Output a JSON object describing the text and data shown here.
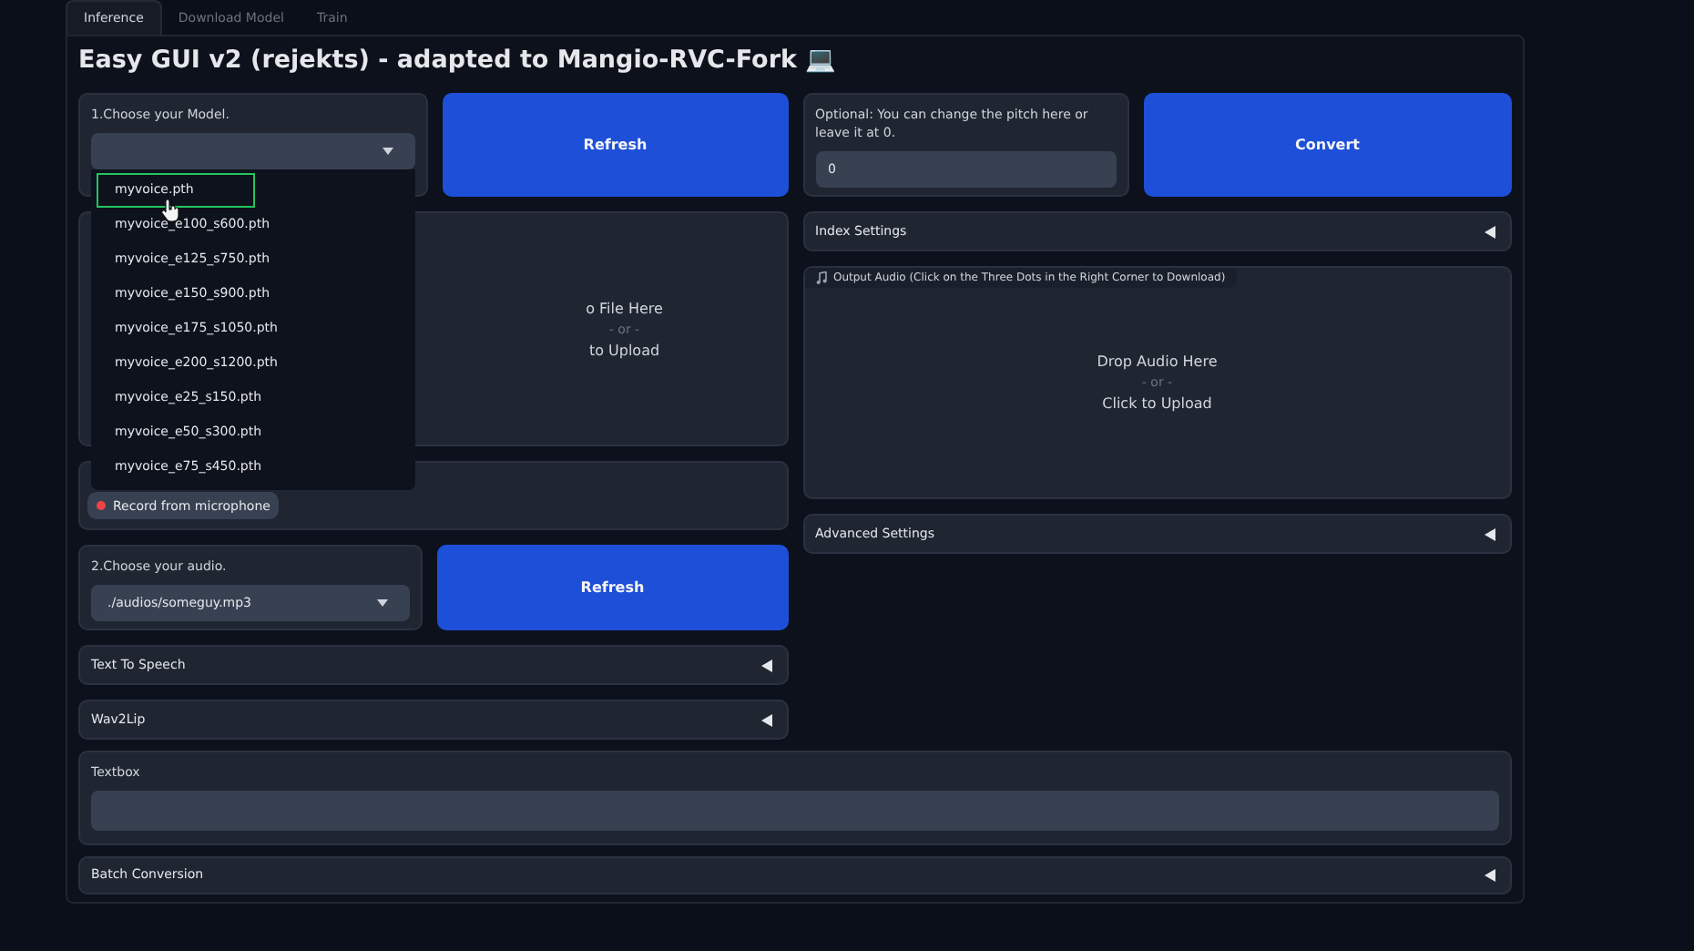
{
  "tabs": [
    {
      "label": "Inference",
      "selected": true
    },
    {
      "label": "Download Model",
      "selected": false
    },
    {
      "label": "Train",
      "selected": false
    }
  ],
  "title": "Easy GUI v2 (rejekts) - adapted to Mangio-RVC-Fork 💻",
  "model_selector": {
    "label": "1.Choose your Model.",
    "expanded": true,
    "options": [
      {
        "label": "myvoice.pth",
        "selected": true
      },
      {
        "label": "myvoice_e100_s600.pth",
        "selected": false
      },
      {
        "label": "myvoice_e125_s750.pth",
        "selected": false
      },
      {
        "label": "myvoice_e150_s900.pth",
        "selected": false
      },
      {
        "label": "myvoice_e175_s1050.pth",
        "selected": false
      },
      {
        "label": "myvoice_e200_s1200.pth",
        "selected": false
      },
      {
        "label": "myvoice_e25_s150.pth",
        "selected": false
      },
      {
        "label": "myvoice_e50_s300.pth",
        "selected": false
      },
      {
        "label": "myvoice_e75_s450.pth",
        "selected": false
      }
    ]
  },
  "refresh_model_button": "Refresh",
  "pitch": {
    "label": "Optional: You can change the pitch here or leave it at 0.",
    "value": "0"
  },
  "convert_button": "Convert",
  "input_audio": {
    "drop_text": "o File Here",
    "separator": "- or -",
    "upload_text": "to Upload"
  },
  "record_button": "Record from microphone",
  "index_settings": {
    "label": "Index Settings",
    "expanded": false
  },
  "output_audio": {
    "label": "Output Audio (Click on the Three Dots in the Right Corner to Download)",
    "drop_text": "Drop Audio Here",
    "separator": "- or -",
    "upload_text": "Click to Upload"
  },
  "advanced_settings": {
    "label": "Advanced Settings",
    "expanded": false
  },
  "audio_selector": {
    "label": "2.Choose your audio.",
    "value": "./audios/someguy.mp3"
  },
  "refresh_audio_button": "Refresh",
  "text_to_speech": {
    "label": "Text To Speech",
    "expanded": false
  },
  "wav2lip": {
    "label": "Wav2Lip",
    "expanded": false
  },
  "textbox": {
    "label": "Textbox"
  },
  "batch_conversion": {
    "label": "Batch Conversion",
    "expanded": false
  }
}
